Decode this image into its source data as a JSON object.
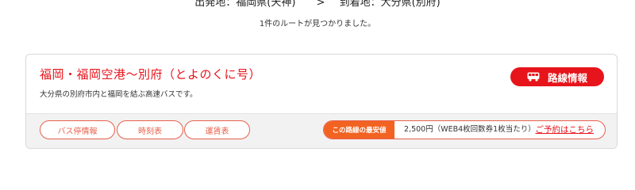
{
  "route_header": {
    "departure": "出発地：福岡県(天神)",
    "separator": ">",
    "arrival": "到着地：大分県(別府)"
  },
  "result_count": "1件のルートが見つかりました。",
  "route": {
    "title": "福岡・福岡空港〜別府（とよのくに号）",
    "description": "大分県の別府市内と福岡を結ぶ高速バスです。",
    "info_button_label": "路線情報",
    "buttons": {
      "bus_stop": "バス停情報",
      "timetable": "時刻表",
      "fare": "運賃表"
    },
    "cheapest_label": "この路線の最安値",
    "cheapest_price": "2,500円（WEB4枚回数券1枚当たり）",
    "reserve_link": "ご予約はこちら"
  },
  "colors": {
    "accent_red": "#e8141b",
    "accent_orange": "#f26322",
    "pill_border": "#e8604c",
    "footer_gray": "#f2f2f2"
  },
  "icons": {
    "bus": "bus-icon"
  }
}
